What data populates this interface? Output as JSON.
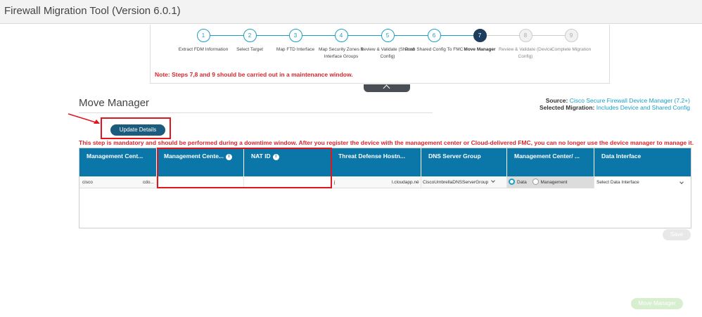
{
  "window": {
    "title": "Firewall Migration Tool (Version 6.0.1)"
  },
  "steps": [
    {
      "num": "1",
      "label": "Extract FDM Information",
      "state": "done"
    },
    {
      "num": "2",
      "label": "Select Target",
      "state": "done"
    },
    {
      "num": "3",
      "label": "Map FTD Interface",
      "state": "done"
    },
    {
      "num": "4",
      "label": "Map Security Zones & Interface Groups",
      "state": "done"
    },
    {
      "num": "5",
      "label": "Review & Validate (Shared Config)",
      "state": "done"
    },
    {
      "num": "6",
      "label": "Push Shared Config To FMC",
      "state": "done"
    },
    {
      "num": "7",
      "label": "Move Manager",
      "state": "active"
    },
    {
      "num": "8",
      "label": "Review & Validate (Device Config)",
      "state": "pending"
    },
    {
      "num": "9",
      "label": "Complete Migration",
      "state": "pending"
    }
  ],
  "note": "Note: Steps 7,8 and 9 should be carried out in a maintenance window.",
  "page": {
    "title": "Move Manager",
    "source_label": "Source:",
    "source_value": "Cisco Secure Firewall Device Manager (7.2+)",
    "migration_label": "Selected Migration:",
    "migration_value": "Includes Device and Shared Config"
  },
  "update_button": "Update Details",
  "warning": "This step is mandatory and should be performed during a downtime window. After you register the device with the management center or Cloud-delivered FMC, you can no longer use the device manager to manage it.",
  "table": {
    "headers": [
      "Management Cent...",
      "Management Cente...",
      "NAT ID",
      "Threat Defense Hostn...",
      "DNS Server Group",
      "Management Center/ ...",
      "Data Interface"
    ],
    "row": {
      "mgmt_center_a": "cisco",
      "mgmt_center_b": "cdo...",
      "hostname_prefix": "j",
      "hostname_suffix": "l.cloudapp.né",
      "dns_group": "CiscoUmbrellaDNSServerGroup",
      "radio_data": "Data",
      "radio_management": "Management",
      "data_interface": "Select Data Interface"
    }
  },
  "save_button": "Save",
  "move_manager_button": "Move Manager",
  "colors": {
    "accent": "#1a9fc4",
    "header": "#0b76a8",
    "alert": "#d9262c",
    "highlight": "#e0161f"
  }
}
